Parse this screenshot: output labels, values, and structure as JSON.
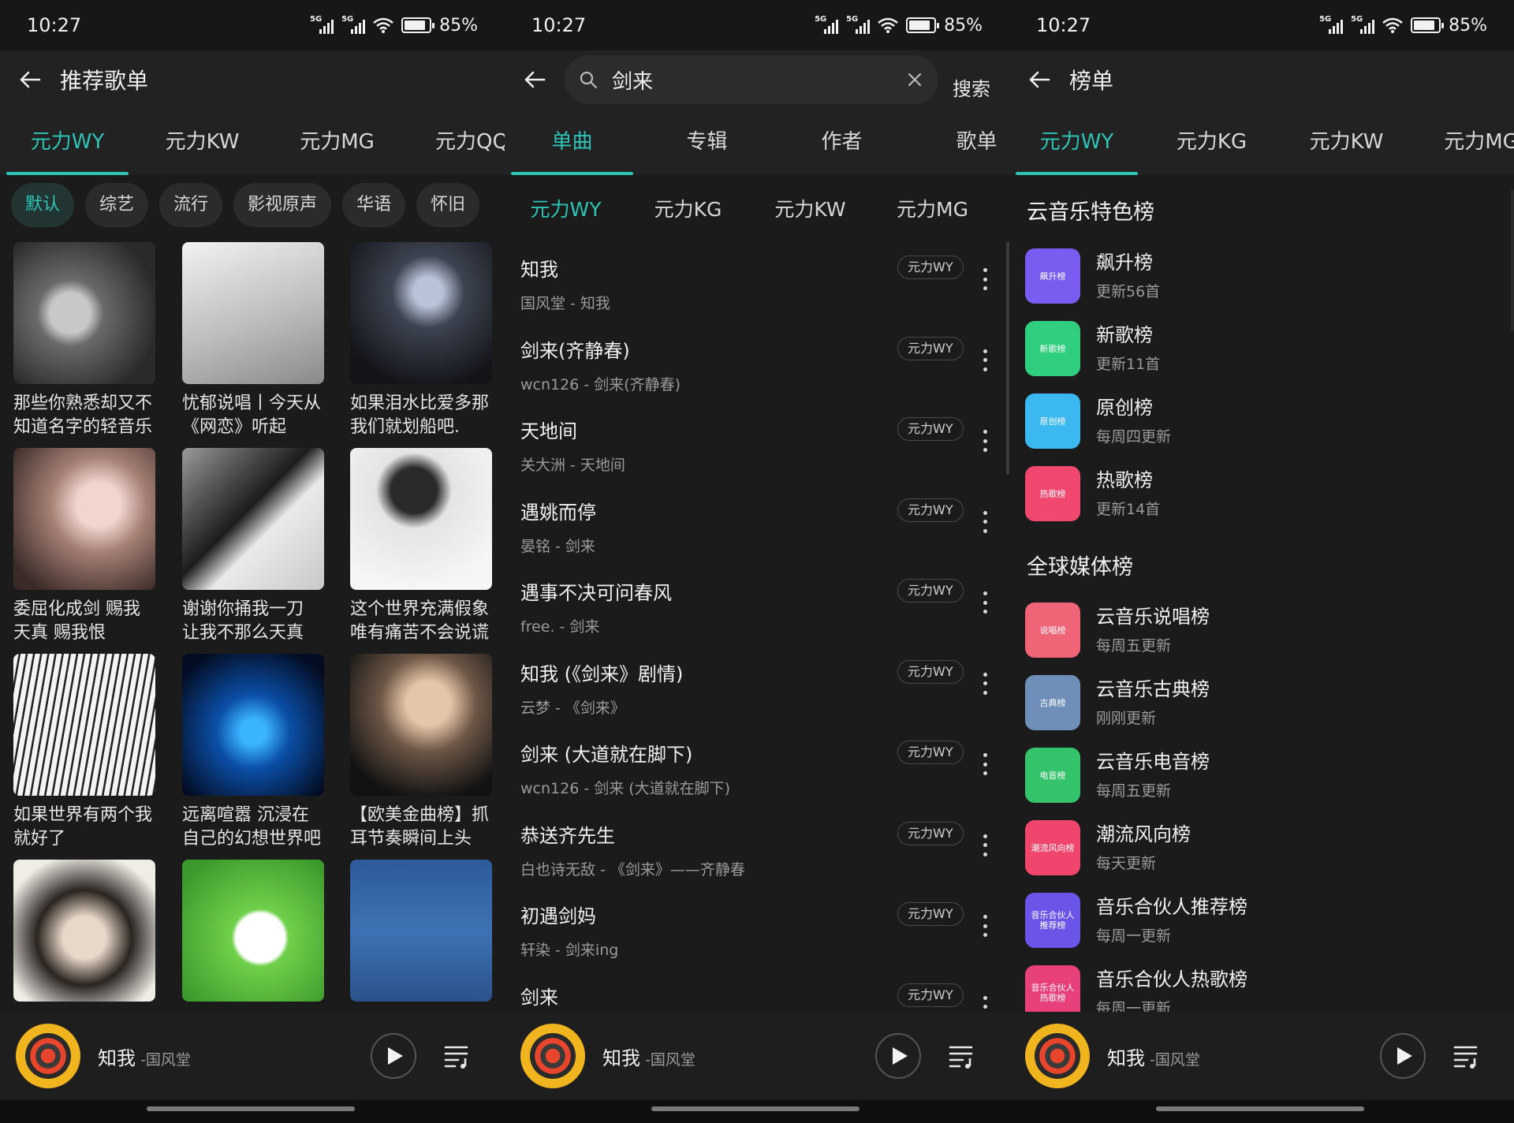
{
  "status": {
    "time": "10:27",
    "battery": "85%",
    "network": "5G"
  },
  "colors": {
    "accent": "#2ec4b6",
    "background": "#1b1b1b"
  },
  "panel1": {
    "title": "推荐歌单",
    "tabs": [
      "元力WY",
      "元力KW",
      "元力MG",
      "元力QQ"
    ],
    "chips": [
      "默认",
      "综艺",
      "流行",
      "影视原声",
      "华语",
      "怀旧"
    ],
    "playlists": [
      {
        "line1": "那些你熟悉却又不",
        "line2": "知道名字的轻音乐"
      },
      {
        "line1": "忧郁说唱丨今天从",
        "line2": "《网恋》听起"
      },
      {
        "line1": "如果泪水比爱多那",
        "line2": "我们就划船吧."
      },
      {
        "line1": "委屈化成剑 赐我",
        "line2": "天真 赐我恨"
      },
      {
        "line1": "谢谢你捅我一刀",
        "line2": "让我不那么天真"
      },
      {
        "line1": "这个世界充满假象",
        "line2": "唯有痛苦不会说谎"
      },
      {
        "line1": "如果世界有两个我",
        "line2": "就好了"
      },
      {
        "line1": "远离喧嚣 沉浸在",
        "line2": "自己的幻想世界吧"
      },
      {
        "line1": "【欧美金曲榜】抓",
        "line2": "耳节奏瞬间上头"
      },
      {
        "line1": "",
        "line2": ""
      },
      {
        "line1": "",
        "line2": ""
      },
      {
        "line1": "",
        "line2": ""
      }
    ]
  },
  "panel2": {
    "search_value": "剑来",
    "search_button": "搜索",
    "tabs": [
      "单曲",
      "专辑",
      "作者",
      "歌单"
    ],
    "sources": [
      "元力WY",
      "元力KG",
      "元力KW",
      "元力MG"
    ],
    "songs": [
      {
        "title": "知我",
        "sub": "国风堂 - 知我",
        "badge": "元力WY"
      },
      {
        "title": "剑来(齐静春)",
        "sub": "wcn126 - 剑来(齐静春)",
        "badge": "元力WY"
      },
      {
        "title": "天地间",
        "sub": "关大洲 - 天地间",
        "badge": "元力WY"
      },
      {
        "title": "遇姚而停",
        "sub": "晏铭 - 剑来",
        "badge": "元力WY"
      },
      {
        "title": "遇事不决可问春风",
        "sub": "free. - 剑来",
        "badge": "元力WY"
      },
      {
        "title": "知我 (《剑来》剧情)",
        "sub": "云梦 - 《剑来》",
        "badge": "元力WY"
      },
      {
        "title": "剑来 (大道就在脚下)",
        "sub": "wcn126 - 剑来 (大道就在脚下)",
        "badge": "元力WY"
      },
      {
        "title": "恭送齐先生",
        "sub": "白也诗无敌 - 《剑来》——齐静春",
        "badge": "元力WY"
      },
      {
        "title": "初遇剑妈",
        "sub": "轩染 - 剑来ing",
        "badge": "元力WY"
      },
      {
        "title": "剑来",
        "sub": "",
        "badge": "元力WY"
      }
    ]
  },
  "panel3": {
    "title": "榜单",
    "tabs": [
      "元力WY",
      "元力KG",
      "元力KW",
      "元力MG"
    ],
    "section1": "云音乐特色榜",
    "section2": "全球媒体榜",
    "featured": [
      {
        "name": "飙升榜",
        "sub": "更新56首",
        "icon": "飙升榜",
        "color": "#7b5cf0"
      },
      {
        "name": "新歌榜",
        "sub": "更新11首",
        "icon": "新歌榜",
        "color": "#2fcf7f"
      },
      {
        "name": "原创榜",
        "sub": "每周四更新",
        "icon": "原创榜",
        "color": "#3bb8f0"
      },
      {
        "name": "热歌榜",
        "sub": "更新14首",
        "icon": "热歌榜",
        "color": "#f0486e"
      }
    ],
    "global": [
      {
        "name": "云音乐说唱榜",
        "sub": "每周五更新",
        "icon": "说唱榜",
        "color": "#f06478"
      },
      {
        "name": "云音乐古典榜",
        "sub": "刚刚更新",
        "icon": "古典榜",
        "color": "#6f8fb8"
      },
      {
        "name": "云音乐电音榜",
        "sub": "每周五更新",
        "icon": "电音榜",
        "color": "#34c26a"
      },
      {
        "name": "潮流风向榜",
        "sub": "每天更新",
        "icon": "潮流风向榜",
        "color": "#f0466e"
      },
      {
        "name": "音乐合伙人推荐榜",
        "sub": "每周一更新",
        "icon": "音乐合伙人推荐榜",
        "color": "#6b55e8"
      },
      {
        "name": "音乐合伙人热歌榜",
        "sub": "每周一更新",
        "icon": "音乐合伙人热歌榜",
        "color": "#e8407a"
      }
    ]
  },
  "player": {
    "song": "知我",
    "artist": "-国风堂"
  }
}
